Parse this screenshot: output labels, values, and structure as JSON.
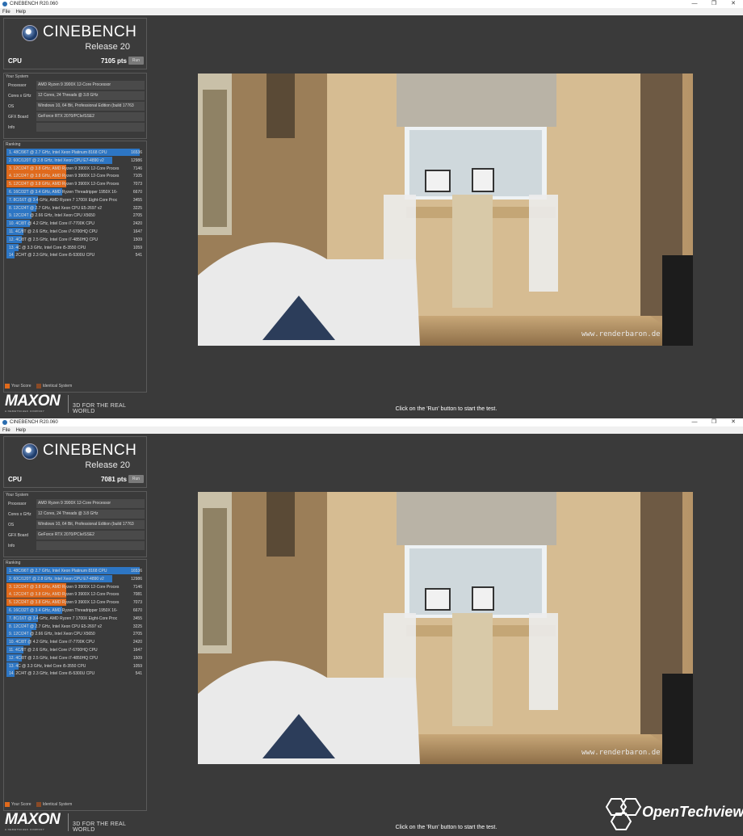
{
  "windows": [
    {
      "title": "CINEBENCH R20.060",
      "menu": [
        "File",
        "Help"
      ],
      "product": {
        "name": "CINEBENCH",
        "release": "Release 20"
      },
      "cpu": {
        "label": "CPU",
        "score": "7105 pts",
        "run_label": "Run"
      },
      "system": {
        "title": "Your System",
        "rows": [
          {
            "key": "Processor",
            "value": "AMD Ryzen 9 3900X 12-Core Processor"
          },
          {
            "key": "Cores x GHz",
            "value": "12 Cores, 24 Threads @ 3.8 GHz"
          },
          {
            "key": "OS",
            "value": "Windows 10, 64 Bit, Professional Edition (build 17763"
          },
          {
            "key": "GFX Board",
            "value": "GeForce RTX 2070/PCIe/SSE2"
          },
          {
            "key": "Info",
            "value": ""
          }
        ]
      },
      "ranking": {
        "title": "Ranking",
        "rows": [
          {
            "label": "1. 48C/96T @ 2.7 GHz, Intel Xeon Platinum 8168 CPU",
            "value": "16536",
            "color": "#2d76c4",
            "fill": 1.0
          },
          {
            "label": "2. 60C/120T @ 2.8 GHz, Intel Xeon CPU E7-4890 v2",
            "value": "12986",
            "color": "#2d76c4",
            "fill": 0.79
          },
          {
            "label": "3. 12C/24T @ 3.8 GHz, AMD Ryzen 9 3900X 12-Core Proces",
            "value": "7146",
            "color": "#e06a1c",
            "fill": 0.43
          },
          {
            "label": "4. 12C/24T @ 3.8 GHz, AMD Ryzen 9 3900X 12-Core Proces",
            "value": "7105",
            "color": "#e06a1c",
            "fill": 0.43
          },
          {
            "label": "5. 12C/24T @ 3.8 GHz, AMD Ryzen 9 3900X 12-Core Proces",
            "value": "7073",
            "color": "#e06a1c",
            "fill": 0.43
          },
          {
            "label": "6. 16C/32T @ 3.4 GHz, AMD Ryzen Threadripper 1950X 16-",
            "value": "6670",
            "color": "#2d76c4",
            "fill": 0.4
          },
          {
            "label": "7. 8C/16T @ 3.4 GHz, AMD Ryzen 7 1700X Eight-Core Proc",
            "value": "3455",
            "color": "#2d76c4",
            "fill": 0.21
          },
          {
            "label": "8. 12C/24T @ 2.7 GHz, Intel Xeon CPU E5-2697 v2",
            "value": "3225",
            "color": "#2d76c4",
            "fill": 0.2
          },
          {
            "label": "9. 12C/24T @ 2.66 GHz, Intel Xeon CPU X5650",
            "value": "2705",
            "color": "#2d76c4",
            "fill": 0.16
          },
          {
            "label": "10. 4C/8T @ 4.2 GHz, Intel Core i7-7700K CPU",
            "value": "2420",
            "color": "#2d76c4",
            "fill": 0.15
          },
          {
            "label": "11. 4C/8T @ 2.6 GHz, Intel Core i7-6700HQ CPU",
            "value": "1647",
            "color": "#2d76c4",
            "fill": 0.1
          },
          {
            "label": "12. 4C/8T @ 2.5 GHz, Intel Core i7-4850HQ CPU",
            "value": "1509",
            "color": "#2d76c4",
            "fill": 0.09
          },
          {
            "label": "13. 4C @ 3.3 GHz, Intel Core i5-3550 CPU",
            "value": "1059",
            "color": "#2d76c4",
            "fill": 0.06
          },
          {
            "label": "14. 2C/4T @ 2.3 GHz, Intel Core i5-5300U CPU",
            "value": "541",
            "color": "#2d76c4",
            "fill": 0.03
          }
        ]
      },
      "legend": {
        "your_score": "Your Score",
        "identical": "Identical System"
      },
      "brand": {
        "logo": "MAXON",
        "sub": "A NEMETSCHEK COMPANY",
        "tagline": "3D FOR THE REAL WORLD"
      },
      "render_watermark": "www.renderbaron.de",
      "status": "Click on the 'Run' button to start the test."
    },
    {
      "title": "CINEBENCH R20.060",
      "menu": [
        "File",
        "Help"
      ],
      "product": {
        "name": "CINEBENCH",
        "release": "Release 20"
      },
      "cpu": {
        "label": "CPU",
        "score": "7081 pts",
        "run_label": "Run"
      },
      "system": {
        "title": "Your System",
        "rows": [
          {
            "key": "Processor",
            "value": "AMD Ryzen 9 3900X 12-Core Processor"
          },
          {
            "key": "Cores x GHz",
            "value": "12 Cores, 24 Threads @ 3.8 GHz"
          },
          {
            "key": "OS",
            "value": "Windows 10, 64 Bit, Professional Edition (build 17763"
          },
          {
            "key": "GFX Board",
            "value": "GeForce RTX 2070/PCIe/SSE2"
          },
          {
            "key": "Info",
            "value": ""
          }
        ]
      },
      "ranking": {
        "title": "Ranking",
        "rows": [
          {
            "label": "1. 48C/96T @ 2.7 GHz, Intel Xeon Platinum 8168 CPU",
            "value": "16536",
            "color": "#2d76c4",
            "fill": 1.0
          },
          {
            "label": "2. 60C/120T @ 2.8 GHz, Intel Xeon CPU E7-4890 v2",
            "value": "12986",
            "color": "#2d76c4",
            "fill": 0.79
          },
          {
            "label": "3. 12C/24T @ 3.8 GHz, AMD Ryzen 9 3900X 12-Core Proces",
            "value": "7146",
            "color": "#e06a1c",
            "fill": 0.43
          },
          {
            "label": "4. 12C/24T @ 3.8 GHz, AMD Ryzen 9 3900X 12-Core Proces",
            "value": "7081",
            "color": "#e06a1c",
            "fill": 0.43
          },
          {
            "label": "5. 12C/24T @ 3.8 GHz, AMD Ryzen 9 3900X 12-Core Proces",
            "value": "7073",
            "color": "#e06a1c",
            "fill": 0.43
          },
          {
            "label": "6. 16C/32T @ 3.4 GHz, AMD Ryzen Threadripper 1950X 16-",
            "value": "6670",
            "color": "#2d76c4",
            "fill": 0.4
          },
          {
            "label": "7. 8C/16T @ 3.4 GHz, AMD Ryzen 7 1700X Eight-Core Proc",
            "value": "3455",
            "color": "#2d76c4",
            "fill": 0.21
          },
          {
            "label": "8. 12C/24T @ 2.7 GHz, Intel Xeon CPU E5-2697 v2",
            "value": "3225",
            "color": "#2d76c4",
            "fill": 0.2
          },
          {
            "label": "9. 12C/24T @ 2.66 GHz, Intel Xeon CPU X5650",
            "value": "2705",
            "color": "#2d76c4",
            "fill": 0.16
          },
          {
            "label": "10. 4C/8T @ 4.2 GHz, Intel Core i7-7700K CPU",
            "value": "2420",
            "color": "#2d76c4",
            "fill": 0.15
          },
          {
            "label": "11. 4C/8T @ 2.6 GHz, Intel Core i7-6700HQ CPU",
            "value": "1647",
            "color": "#2d76c4",
            "fill": 0.1
          },
          {
            "label": "12. 4C/8T @ 2.5 GHz, Intel Core i7-4850HQ CPU",
            "value": "1509",
            "color": "#2d76c4",
            "fill": 0.09
          },
          {
            "label": "13. 4C @ 3.3 GHz, Intel Core i5-3550 CPU",
            "value": "1059",
            "color": "#2d76c4",
            "fill": 0.06
          },
          {
            "label": "14. 2C/4T @ 2.3 GHz, Intel Core i5-5300U CPU",
            "value": "541",
            "color": "#2d76c4",
            "fill": 0.03
          }
        ]
      },
      "legend": {
        "your_score": "Your Score",
        "identical": "Identical System"
      },
      "brand": {
        "logo": "MAXON",
        "sub": "A NEMETSCHEK COMPANY",
        "tagline": "3D FOR THE REAL WORLD"
      },
      "render_watermark": "www.renderbaron.de",
      "status": "Click on the 'Run' button to start the test."
    }
  ],
  "overlay_logo": {
    "text": "OpenTechview"
  },
  "icons": {
    "minimize": "minimize-icon",
    "maximize": "restore-icon",
    "close": "close-icon",
    "app": "cinebench-icon"
  }
}
